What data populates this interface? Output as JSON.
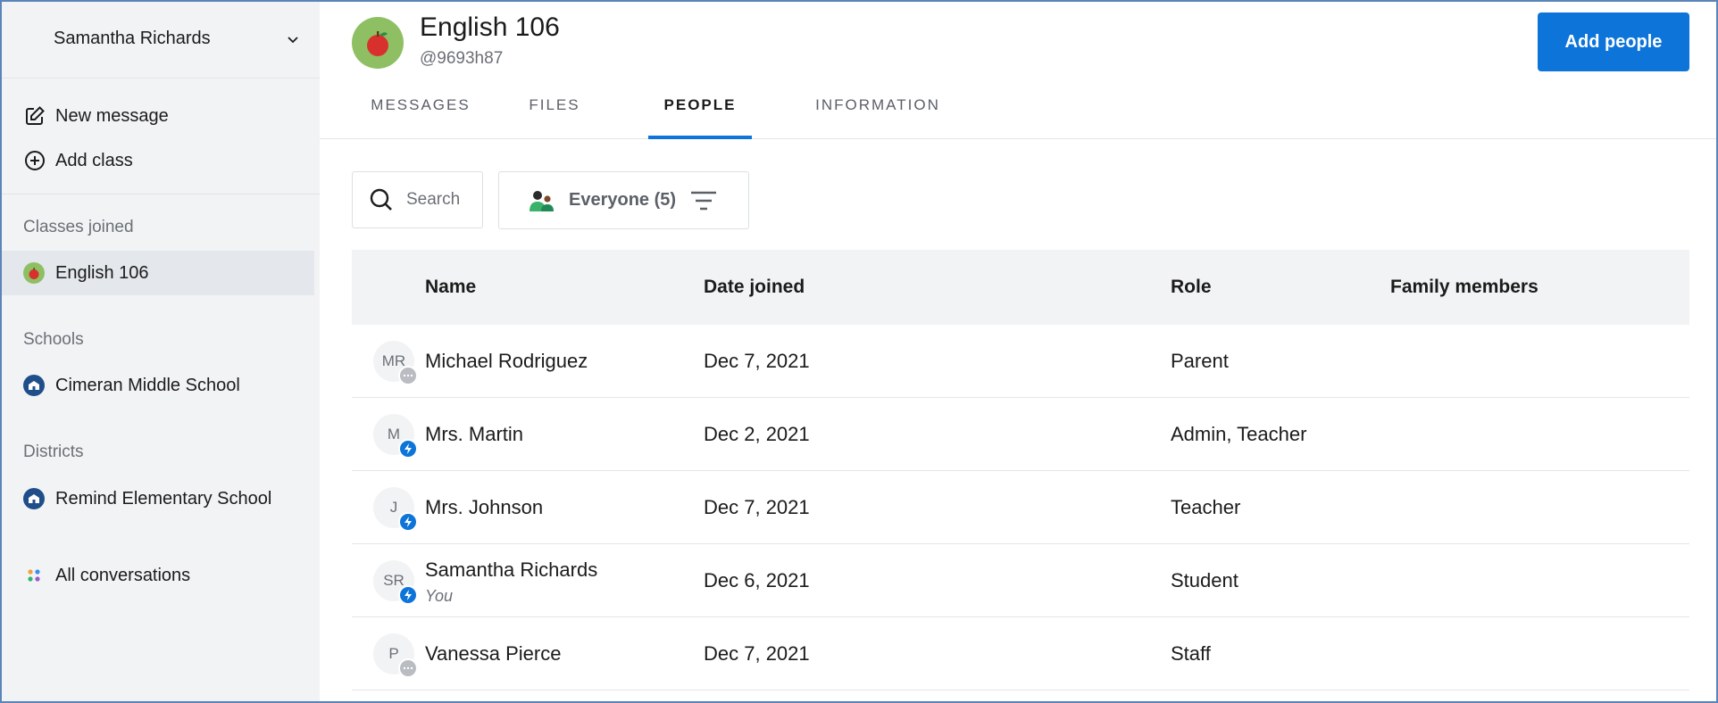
{
  "sidebar": {
    "user_name": "Samantha Richards",
    "actions": [
      {
        "label": "New message",
        "icon": "edit-icon"
      },
      {
        "label": "Add class",
        "icon": "plus-circle-icon"
      }
    ],
    "classes_heading": "Classes joined",
    "classes": [
      {
        "label": "English 106",
        "icon": "apple-icon"
      }
    ],
    "schools_heading": "Schools",
    "schools": [
      {
        "label": "Cimeran Middle School",
        "icon": "school-icon"
      }
    ],
    "districts_heading": "Districts",
    "districts": [
      {
        "label": "Remind Elementary School",
        "icon": "school-icon"
      }
    ],
    "all_conversations": "All conversations"
  },
  "header": {
    "title": "English 106",
    "code": "@9693h87",
    "add_button": "Add people"
  },
  "tabs": [
    {
      "label": "MESSAGES",
      "active": false
    },
    {
      "label": "FILES",
      "active": false
    },
    {
      "label": "PEOPLE",
      "active": true
    },
    {
      "label": "INFORMATION",
      "active": false
    }
  ],
  "toolbar": {
    "search_placeholder": "Search",
    "filter_label": "Everyone (5)"
  },
  "table": {
    "headers": {
      "name": "Name",
      "date": "Date joined",
      "role": "Role",
      "family": "Family members"
    },
    "rows": [
      {
        "initials": "MR",
        "name": "Michael Rodriguez",
        "date": "Dec 7, 2021",
        "role": "Parent",
        "status": "grey"
      },
      {
        "initials": "M",
        "name": "Mrs. Martin",
        "date": "Dec 2, 2021",
        "role": "Admin, Teacher",
        "status": "blue"
      },
      {
        "initials": "J",
        "name": "Mrs. Johnson",
        "date": "Dec 7, 2021",
        "role": "Teacher",
        "status": "blue"
      },
      {
        "initials": "SR",
        "name": "Samantha Richards",
        "sub": "You",
        "date": "Dec 6, 2021",
        "role": "Student",
        "status": "blue"
      },
      {
        "initials": "P",
        "name": "Vanessa Pierce",
        "date": "Dec 7, 2021",
        "role": "Staff",
        "status": "grey"
      }
    ]
  },
  "colors": {
    "accent": "#0d74d9",
    "sidebar_bg": "#f2f3f5"
  }
}
